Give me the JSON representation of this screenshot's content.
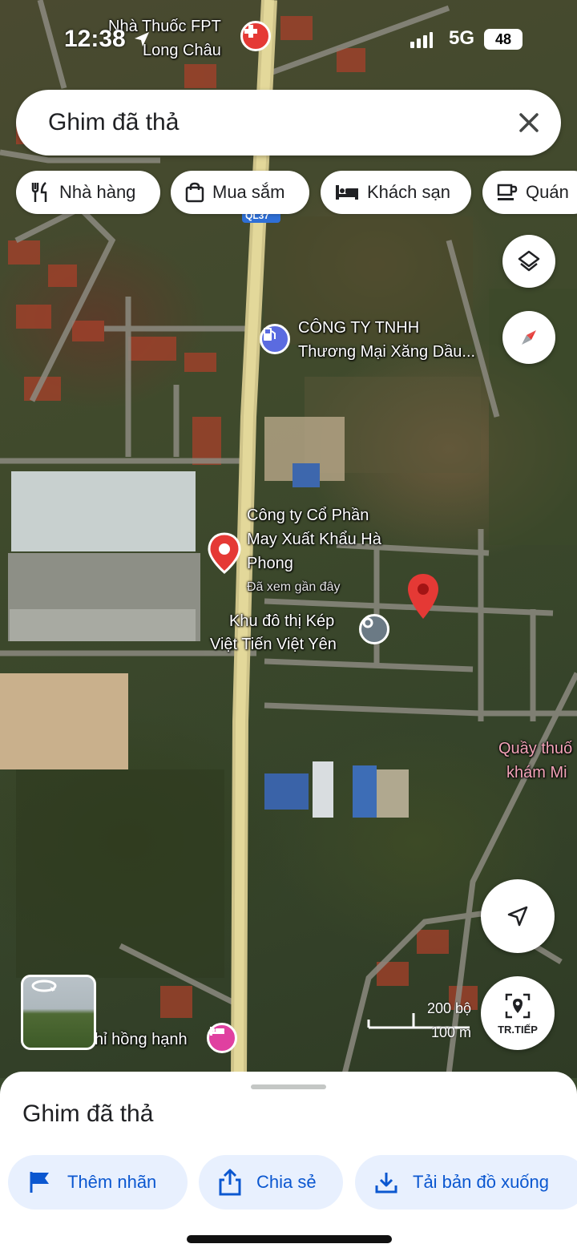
{
  "status_bar": {
    "time": "12:38",
    "network": "5G",
    "battery": "48"
  },
  "search": {
    "query": "Ghim đã thả"
  },
  "chips": [
    {
      "label": "Nhà hàng",
      "icon": "fork-knife-icon"
    },
    {
      "label": "Mua sắm",
      "icon": "shopping-bag-icon"
    },
    {
      "label": "Khách sạn",
      "icon": "bed-icon"
    },
    {
      "label": "Quán",
      "icon": "coffee-cup-icon"
    }
  ],
  "map": {
    "labels": {
      "pharmacy_line1": "Nhà Thuốc FPT",
      "pharmacy_line2": "Long Châu",
      "road": "QL37",
      "gas_line1": "CÔNG TY TNHH",
      "gas_line2": "Thương Mại Xăng Dầu...",
      "company_line1": "Công ty Cổ Phần",
      "company_line2": "May Xuất Khẩu Hà",
      "company_line3": "Phong",
      "company_note": "Đã xem gần đây",
      "urban_line1": "Khu đô thị Kép",
      "urban_line2": "Việt Tiến Việt Yên",
      "clinic_line1": "Quầy thuố",
      "clinic_line2": "khám Mi",
      "hotel": "hỉ hồng hạnh"
    },
    "scale": {
      "imperial": "200 bộ",
      "metric": "100 m"
    },
    "directions_label": "TR.TIẾP"
  },
  "sheet": {
    "title": "Ghim đã thả",
    "actions": [
      {
        "label": "Thêm nhãn",
        "icon": "flag-icon"
      },
      {
        "label": "Chia sẻ",
        "icon": "share-icon"
      },
      {
        "label": "Tải bản đồ xuống",
        "icon": "download-icon"
      }
    ]
  },
  "colors": {
    "accent": "#0b57d0",
    "pin_red": "#e53935",
    "chip_bg": "#ffffff",
    "action_bg": "#e8f0fe"
  }
}
